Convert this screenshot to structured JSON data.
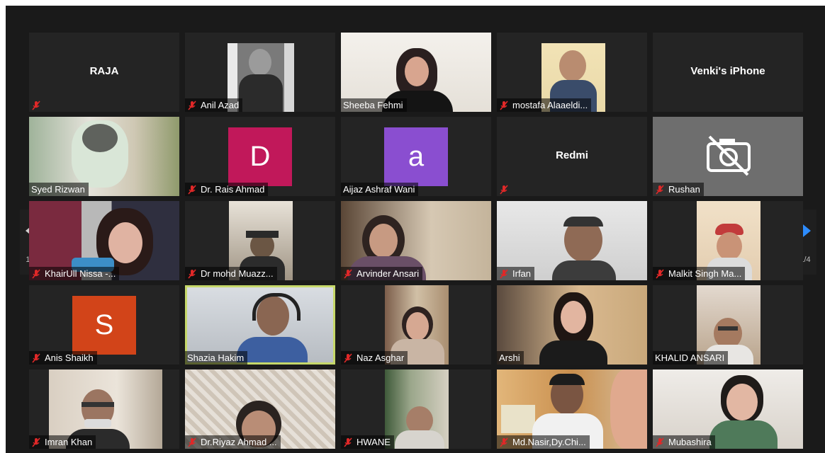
{
  "meeting": {
    "page_indicator_left": "1/4",
    "page_indicator_right": "1/4",
    "colors": {
      "frame": "#1a1a1a",
      "tile": "#242424",
      "active_speaker": "#c6d86a",
      "nav_arrow_right": "#2d8cff",
      "nav_arrow_left": "#cfcfcf",
      "mute_icon": "#e02828"
    }
  },
  "participants": [
    {
      "name": "",
      "center_label": "RAJA",
      "muted": true,
      "video": "off"
    },
    {
      "name": "Anil Azad",
      "muted": true,
      "video": "on"
    },
    {
      "name": "Sheeba Fehmi",
      "muted": false,
      "video": "on"
    },
    {
      "name": "mostafa Alaaeldi...",
      "muted": true,
      "video": "on"
    },
    {
      "name": "",
      "center_label": "Venki's iPhone",
      "muted": false,
      "video": "off"
    },
    {
      "name": "Syed Rizwan",
      "muted": false,
      "video": "on"
    },
    {
      "name": "Dr. Rais Ahmad",
      "muted": true,
      "video": "off",
      "avatar_letter": "D",
      "avatar_color": "#c1185a"
    },
    {
      "name": "Aijaz  Ashraf Wani",
      "muted": false,
      "video": "off",
      "avatar_letter": "a",
      "avatar_color": "#8a4ed0"
    },
    {
      "name": "",
      "center_label": "Redmi",
      "muted": true,
      "video": "off"
    },
    {
      "name": "Rushan",
      "muted": true,
      "video": "off",
      "icon": "camera-off-icon"
    },
    {
      "name": "KhairUll Nissa -...",
      "muted": true,
      "video": "on"
    },
    {
      "name": "Dr mohd Muazz...",
      "muted": true,
      "video": "on"
    },
    {
      "name": "Arvinder Ansari",
      "muted": true,
      "video": "on"
    },
    {
      "name": "Irfan",
      "muted": true,
      "video": "on"
    },
    {
      "name": "Malkit Singh Ma...",
      "muted": true,
      "video": "on"
    },
    {
      "name": "Anis Shaikh",
      "muted": true,
      "video": "off",
      "avatar_letter": "S",
      "avatar_color": "#d24419"
    },
    {
      "name": "Shazia Hakim",
      "muted": false,
      "video": "on",
      "active": true
    },
    {
      "name": "Naz Asghar",
      "muted": true,
      "video": "on"
    },
    {
      "name": "Arshi",
      "muted": false,
      "video": "on"
    },
    {
      "name": "KHALID ANSARI",
      "muted": false,
      "video": "on"
    },
    {
      "name": "Imran Khan",
      "muted": true,
      "video": "on"
    },
    {
      "name": "Dr.Riyaz Ahmad ...",
      "muted": true,
      "video": "on"
    },
    {
      "name": "HWANE",
      "muted": true,
      "video": "on"
    },
    {
      "name": "Md.Nasir,Dy.Chi...",
      "muted": true,
      "video": "on"
    },
    {
      "name": "Mubashira",
      "muted": true,
      "video": "on"
    }
  ]
}
